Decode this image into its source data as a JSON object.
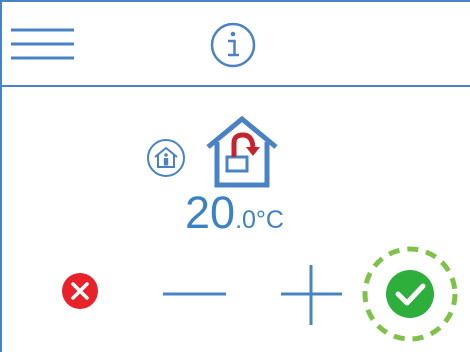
{
  "header": {
    "menu_icon": "hamburger-menu-icon",
    "info_icon": "info-icon"
  },
  "status": {
    "mode_icon": "indoor-person-icon",
    "house_icon": "home-return-icon"
  },
  "temperature": {
    "integer": "20",
    "decimal": ".0",
    "unit": "°C"
  },
  "controls": {
    "cancel_icon": "cancel-icon",
    "decrease_icon": "minus-icon",
    "increase_icon": "plus-icon",
    "confirm_icon": "confirm-check-icon"
  },
  "colors": {
    "accent": "#3b82c4",
    "cancel": "#e8222b",
    "confirm": "#2eae3b",
    "focus_ring": "#7fc24a"
  }
}
